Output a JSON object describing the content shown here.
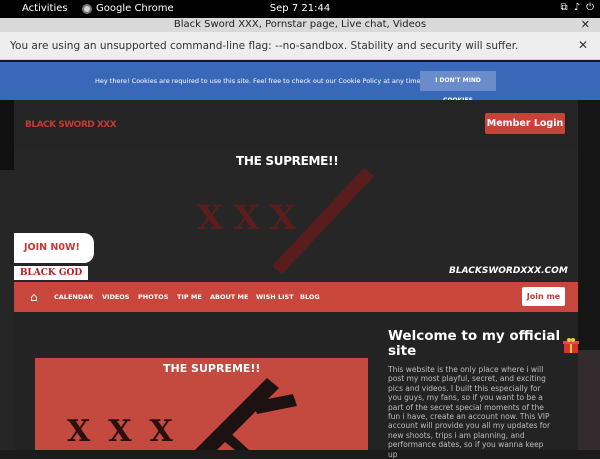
{
  "system": {
    "activities": "Activities",
    "app_name": "Google Chrome",
    "clock": "Sep 7  21:44"
  },
  "window": {
    "title": "Black Sword XXX, Pornstar page, Live chat, Videos"
  },
  "infobar": {
    "message": "You are using an unsupported command-line flag: --no-sandbox. Stability and security will suffer."
  },
  "cookie": {
    "text": "Hey there! Cookies are required to use this site. Feel free to check out our Cookie Policy at any time.",
    "button": "I DON'T MIND COOKIES"
  },
  "site": {
    "logo": "BLACK SWORD XXX",
    "member_login": "Member Login",
    "hero": {
      "tagline": "THE SUPREME!!",
      "xxx": "XXX",
      "url": "BLACKSWORDXXX.COM",
      "join_now": "JOIN N0W!",
      "black_god": "BLACK GOD"
    },
    "nav": {
      "items": [
        "CALENDAR",
        "VIDEOS",
        "PHOTOS",
        "TIP ME",
        "ABOUT ME",
        "WISH LIST",
        "BLOG"
      ],
      "join": "Join me"
    },
    "promo": {
      "tagline": "THE SUPREME!!",
      "xxx": "XXX"
    },
    "welcome": {
      "title": "Welcome to my official site",
      "body": "This website is the only place where i will post my most playful, secret, and exciting pics and videos. I built this especially for you guys, my fans, so if you want to be a part of the secret special moments of the fun i have, create an account now. This VIP account will provide you all my updates for new shoots, trips i am planning, and performance dates, so if you wanna keep up"
    }
  },
  "colors": {
    "accent_red": "#c9463d",
    "cookie_blue": "#3a68b8"
  }
}
